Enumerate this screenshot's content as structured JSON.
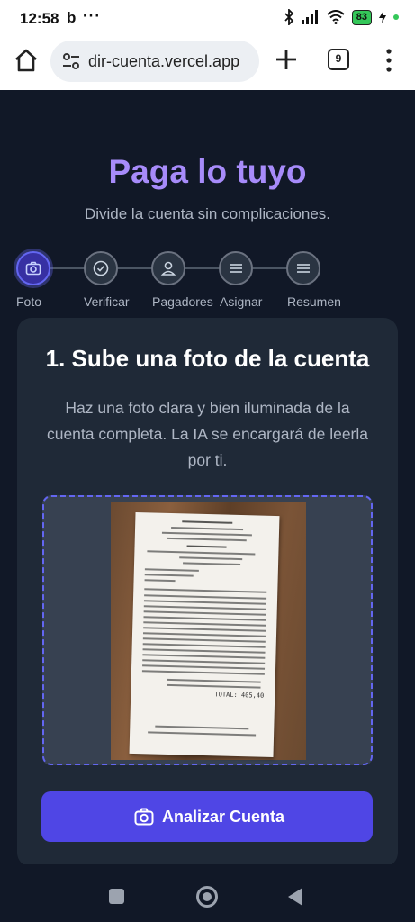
{
  "status_bar": {
    "time": "12:58",
    "notification_glyph": "b",
    "more_dots": "···",
    "battery": "83",
    "icons": [
      "bluetooth-icon",
      "signal-icon",
      "wifi-icon",
      "battery-icon",
      "charging-icon"
    ]
  },
  "browser": {
    "url": "dir-cuenta.vercel.app",
    "tab_count": "9",
    "icons": [
      "home-icon",
      "site-settings-icon",
      "new-tab-icon",
      "tabs-icon",
      "menu-icon"
    ]
  },
  "app": {
    "title": "Paga lo tuyo",
    "subtitle": "Divide la cuenta sin complicaciones.",
    "accent_color": "#a78bfa",
    "button_color": "#4f46e5",
    "steps": [
      {
        "label": "Foto",
        "icon": "camera-icon",
        "active": true
      },
      {
        "label": "Verificar",
        "icon": "check-circle-icon",
        "active": false
      },
      {
        "label": "Pagadores",
        "icon": "user-icon",
        "active": false
      },
      {
        "label": "Asignar",
        "icon": "list-icon",
        "active": false
      },
      {
        "label": "Resumen",
        "icon": "list-icon",
        "active": false
      }
    ],
    "card": {
      "title": "1. Sube una foto de la cuenta",
      "description": "Haz una foto clara y bien iluminada de la cuenta completa. La IA se encargará de leerla por ti.",
      "receipt_header": "DECONTRABANDO",
      "receipt_total": "TOTAL: 405,40",
      "analyze_button": "Analizar Cuenta"
    }
  }
}
